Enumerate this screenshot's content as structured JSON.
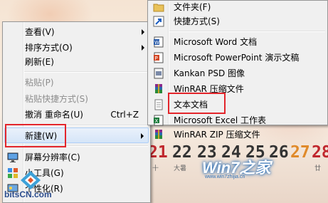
{
  "main_menu": {
    "items": [
      {
        "label": "查看(V)",
        "type": "submenu"
      },
      {
        "label": "排序方式(O)",
        "type": "submenu"
      },
      {
        "label": "刷新(E)",
        "type": "normal"
      },
      {
        "label": "粘贴(P)",
        "type": "disabled"
      },
      {
        "label": "粘贴快捷方式(S)",
        "type": "disabled"
      },
      {
        "label": "撤消 重命名(U)",
        "shortcut": "Ctrl+Z",
        "type": "normal"
      },
      {
        "label": "新建(W)",
        "type": "submenu-selected"
      },
      {
        "label": "屏幕分辨率(C)",
        "type": "normal"
      },
      {
        "label": "小工具(G)",
        "type": "normal"
      },
      {
        "label": "个性化(R)",
        "type": "normal"
      }
    ]
  },
  "new_submenu": {
    "items": [
      {
        "label": "文件夹(F)",
        "icon": "folder-icon"
      },
      {
        "label": "快捷方式(S)",
        "icon": "shortcut-icon"
      },
      {
        "label": "Microsoft Word 文档",
        "icon": "word-icon"
      },
      {
        "label": "Microsoft PowerPoint 演示文稿",
        "icon": "powerpoint-icon"
      },
      {
        "label": "Kankan PSD 图像",
        "icon": "psd-icon"
      },
      {
        "label": "WinRAR 压缩文件",
        "icon": "winrar-icon"
      },
      {
        "label": "文本文档",
        "icon": "text-document-icon"
      },
      {
        "label": "Microsoft Excel 工作表",
        "icon": "excel-icon"
      },
      {
        "label": "WinRAR ZIP 压缩文件",
        "icon": "winrar-zip-icon"
      }
    ]
  },
  "desktop": {
    "calendar_numbers": [
      "21",
      "22",
      "23",
      "24",
      "25",
      "26",
      "27",
      "28"
    ],
    "calendar_sub": [
      "十",
      "大暑",
      "廿"
    ],
    "win7_logo": "Win7之家",
    "win7_url": "www.win7zhijia.cn",
    "bitscn": "bitsCN.com"
  },
  "colors": {
    "highlight_border": "#e3252b",
    "menu_bg": "#f0f0f0"
  }
}
